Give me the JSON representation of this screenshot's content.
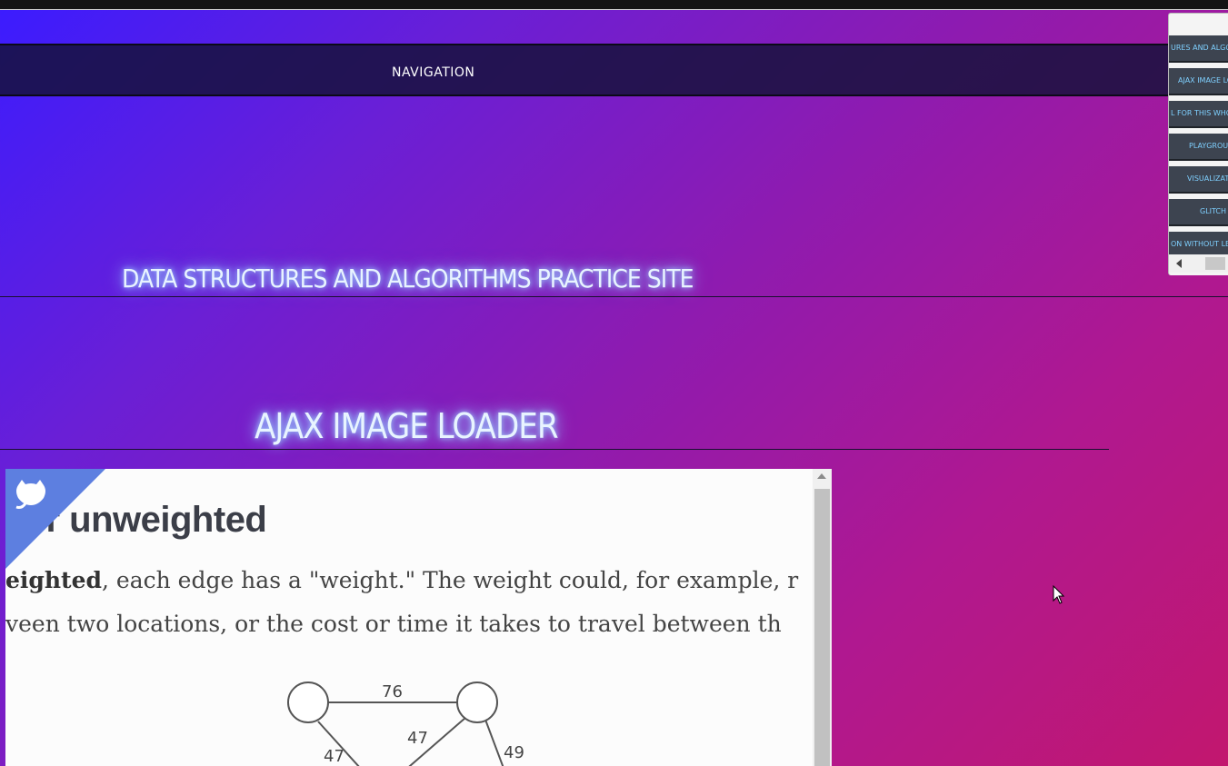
{
  "navbar": {
    "label": "NAVIGATION"
  },
  "site": {
    "title": "DATA STRUCTURES AND ALGORITHMS PRACTICE SITE"
  },
  "section": {
    "title": "AJAX IMAGE LOADER"
  },
  "viewer": {
    "heading": "d or unweighted",
    "para1_bold": "eighted",
    "para1_rest": ", each edge has a \"weight.\" The weight could, for example, r",
    "para2": "veen two locations, or the cost or time it takes to travel between th",
    "graph_weights": [
      "76",
      "47",
      "47",
      "49"
    ]
  },
  "sidebar": {
    "items": [
      {
        "label": "URES AND ALGORI"
      },
      {
        "label": "AJAX IMAGE LO"
      },
      {
        "label": "L FOR THIS WHOL"
      },
      {
        "label": "PLAYGROU"
      },
      {
        "label": "VISUALIZAT"
      },
      {
        "label": "GLITCH"
      },
      {
        "label": "ON WITHOUT LE"
      }
    ]
  },
  "icons": [
    "github-octocat-icon",
    "scroll-up-icon",
    "scroll-left-icon",
    "mouse-cursor-icon"
  ],
  "colors": {
    "nav_bg": "#16123c",
    "accent_glow": "#9fd0ff",
    "corner": "#5d7fe0",
    "sidebtn_bg": "#3d4450",
    "sidebtn_text": "#7fd0ff"
  }
}
